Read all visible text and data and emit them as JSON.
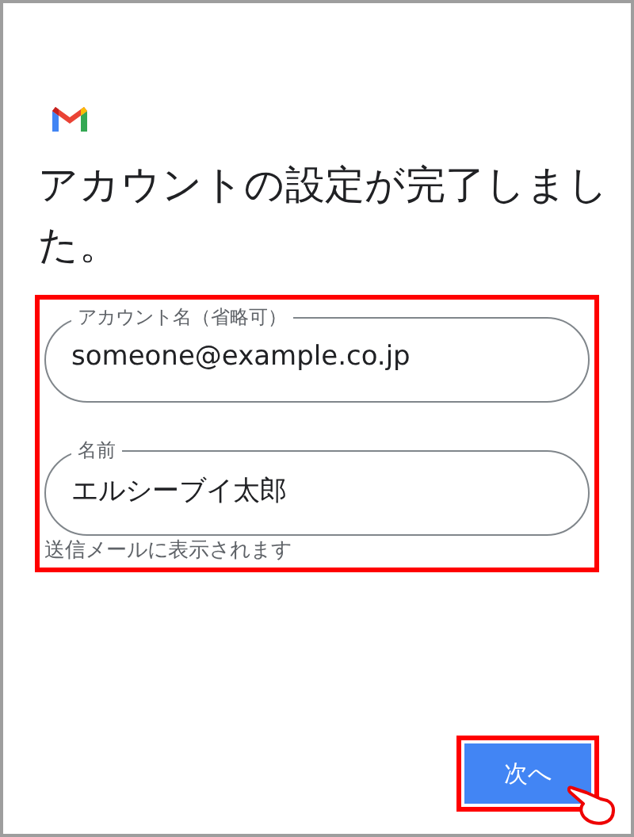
{
  "title": "アカウントの設定が完了しました。",
  "fields": [
    {
      "label": "アカウント名（省略可）",
      "value": "someone@example.co.jp"
    },
    {
      "label": "名前",
      "value": "エルシーブイ太郎"
    }
  ],
  "helper": "送信メールに表示されます",
  "button": "次へ"
}
